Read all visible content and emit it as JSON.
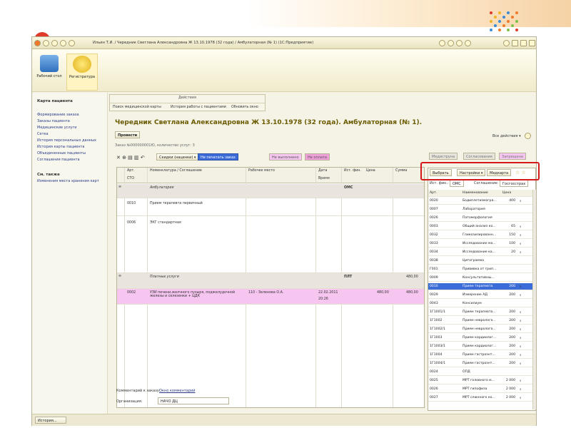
{
  "window": {
    "title": "Ильин Т.И. / Чередник Светлана Александровна Ж 13.10.1978 (32 года) / Амбулаторная (№ 1) (1С:Предприятие)"
  },
  "sections": [
    {
      "label": "Рабочий стол"
    },
    {
      "label": "Регистратура"
    }
  ],
  "sidebar": {
    "header": "Карта пациента",
    "items": [
      "Формирование заказа",
      "Заказы пациента",
      "Медицинские услуги",
      "Сетка",
      "История персональных данных",
      "История карты пациента",
      "Объединенные пациенты",
      "Соглашения пациента"
    ],
    "see_also_header": "См. также",
    "see_also_items": [
      "Изменения места хранения карт"
    ]
  },
  "actions": {
    "caption": "Действия",
    "items": [
      "Поиск медицинской карты",
      "История работы с пациентами",
      "Обновить окно"
    ]
  },
  "document": {
    "title": "Чередник Светлана Александровна Ж 13.10.1978 (32 года). Амбулаторная (№ 1).",
    "all_actions": "Все действия ▾",
    "post_button": "Провести",
    "order_info": "Заказ №000000001Ю, количество услуг: 3"
  },
  "toolbar": {
    "set_discount": "Скидки (наценки) ▾",
    "print_button": "Не печатать заказ",
    "unfilled": "Не выполнено",
    "not_paid": "Не оплата"
  },
  "grid": {
    "headers": [
      "Арт.",
      "Номенклатура / Соглашение",
      "Рабочее место",
      "Дата",
      "Ист. фин.",
      "Цена",
      "Сумма"
    ],
    "headers2": [
      "СТО",
      "",
      "",
      "Время",
      "",
      "",
      ""
    ],
    "rows": [
      {
        "art": "",
        "name": "Амбулатория",
        "place": "",
        "date": "",
        "fin": "ОМС",
        "price": "",
        "sum": ""
      },
      {
        "art": "0010",
        "name": "Прием терапевта первичный",
        "place": "",
        "date": "",
        "fin": "",
        "price": "",
        "sum": ""
      },
      {
        "art": "0006",
        "name": "ЭКГ стандартная",
        "place": "",
        "date": "",
        "fin": "",
        "price": "",
        "sum": ""
      },
      {
        "art": "",
        "name": "Платные услуги",
        "place": "",
        "date": "",
        "fin": "ПЛТ",
        "price": "",
        "sum": "480,00"
      },
      {
        "art": "0002",
        "name": "УЗИ печени,желчного пузыря, поджелудочной железы и селезенки + ЦДК",
        "place": "110 - Зеленова О.А.",
        "date": "22.02.2011",
        "time": "20:26",
        "fin": "",
        "price": "480,00",
        "sum": "480,00"
      }
    ]
  },
  "comment": {
    "label": "Комментарий к заказу:",
    "link": "Окно комментарий",
    "org_label": "Организация:",
    "org_value": "НАЧО ДЦ"
  },
  "right_panel": {
    "tabs": [
      "Медиструна",
      "Согласования",
      "Запрещена"
    ],
    "toolbar": [
      "Выбрать",
      "Настройки ▾",
      "Медкарта"
    ],
    "filter": {
      "source_label": "Ист. фин.:",
      "source_value": "ОМС",
      "agreement_label": "Соглашение:",
      "agreement_value": "Госгосстрах"
    },
    "headers": [
      "Арт.",
      "Наименование",
      "Цена"
    ],
    "rows": [
      {
        "art": "0020",
        "name": "Бодиплетизмогра...",
        "price": "400"
      },
      {
        "art": "0007",
        "name": "Лаборатория",
        "price": ""
      },
      {
        "art": "0026",
        "name": "Патоморфология",
        "price": ""
      },
      {
        "art": "0003",
        "name": "Общий анализ ко...",
        "price": "65"
      },
      {
        "art": "0032",
        "name": "Гликозилированн...",
        "price": "150"
      },
      {
        "art": "0033",
        "name": "Исследование ма...",
        "price": "100"
      },
      {
        "art": "0034",
        "name": "Исследование ка...",
        "price": "20"
      },
      {
        "art": "0038",
        "name": "Цитограмма",
        "price": ""
      },
      {
        "art": "Г001",
        "name": "Прививка от грип...",
        "price": ""
      },
      {
        "art": "0009",
        "name": "Консультативны...",
        "price": ""
      },
      {
        "art": "0010",
        "name": "Прием терапевта",
        "price": "200"
      },
      {
        "art": "0029",
        "name": "Измерение АД",
        "price": "200"
      },
      {
        "art": "0043",
        "name": "Консилиум",
        "price": ""
      },
      {
        "art": "1Г1001/1",
        "name": "Прием терапевта...",
        "price": "200"
      },
      {
        "art": "1Г1002",
        "name": "Прием невролога...",
        "price": "200"
      },
      {
        "art": "1Г1002/1",
        "name": "Прием невролога...",
        "price": "200"
      },
      {
        "art": "1Г1003",
        "name": "Прием кардиолог...",
        "price": "200"
      },
      {
        "art": "1Г1003/1",
        "name": "Прием кардиолог...",
        "price": "200"
      },
      {
        "art": "1Г1004",
        "name": "Прием гастроэнт...",
        "price": "200"
      },
      {
        "art": "1Г1004/1",
        "name": "Прием гастроэнт...",
        "price": "200"
      },
      {
        "art": "0024",
        "name": "ОПД",
        "price": ""
      },
      {
        "art": "0025",
        "name": "МРТ головного м...",
        "price": "2 000"
      },
      {
        "art": "0026",
        "name": "МРТ гипофиза",
        "price": "2 000"
      },
      {
        "art": "0027",
        "name": "МРТ слюнного ко...",
        "price": "2 000"
      }
    ]
  },
  "taskbar": {
    "history": "История..."
  },
  "colors": {
    "highlight_row": "#f6c6f0",
    "accent_red": "#d21a1a"
  }
}
